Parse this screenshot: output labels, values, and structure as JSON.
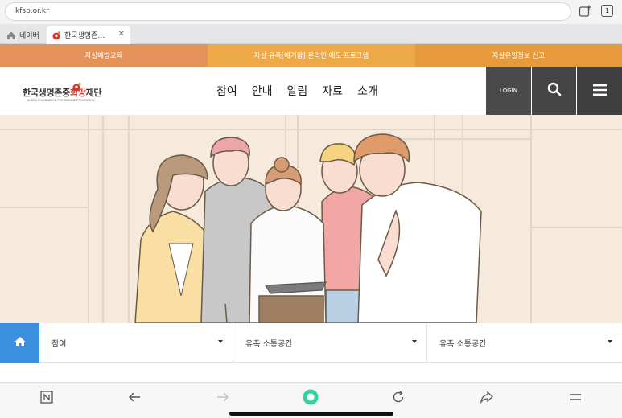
{
  "browser": {
    "url": "kfsp.or.kr",
    "tab_count": "1",
    "tabs": [
      {
        "label": "네이버"
      },
      {
        "label": "한국생명존…"
      }
    ]
  },
  "topnav": {
    "items": [
      "자살예방교육",
      "자살 유족[애기함] 온라인 애도 프로그램",
      "자살유발정보 신고"
    ],
    "colors": [
      "#e4915a",
      "#eda947",
      "#e79a3c"
    ]
  },
  "header": {
    "logo_prefix": "한국생명존중",
    "logo_highlight": "희망",
    "logo_suffix": "재단",
    "logo_subtitle": "KOREA FOUNDATION FOR SUICIDE PREVENTION",
    "nav": [
      "참여",
      "안내",
      "알림",
      "자료",
      "소개"
    ],
    "login_label": "LOGIN",
    "search_icon": "search-icon",
    "menu_icon": "hamburger-menu-icon"
  },
  "breadcrumb": {
    "home_icon": "home-icon",
    "items": [
      "참여",
      "유족 소통공간",
      "유족 소통공간"
    ]
  },
  "toolbar": {
    "icons": [
      "naver-n-icon",
      "back-arrow-icon",
      "forward-arrow-icon",
      "green-dot-icon",
      "reload-icon",
      "share-icon",
      "menu-icon"
    ]
  },
  "colors": {
    "accent_blue": "#3d8fe0",
    "header_dark": "#444444",
    "hero_bg": "#f5eadc"
  }
}
